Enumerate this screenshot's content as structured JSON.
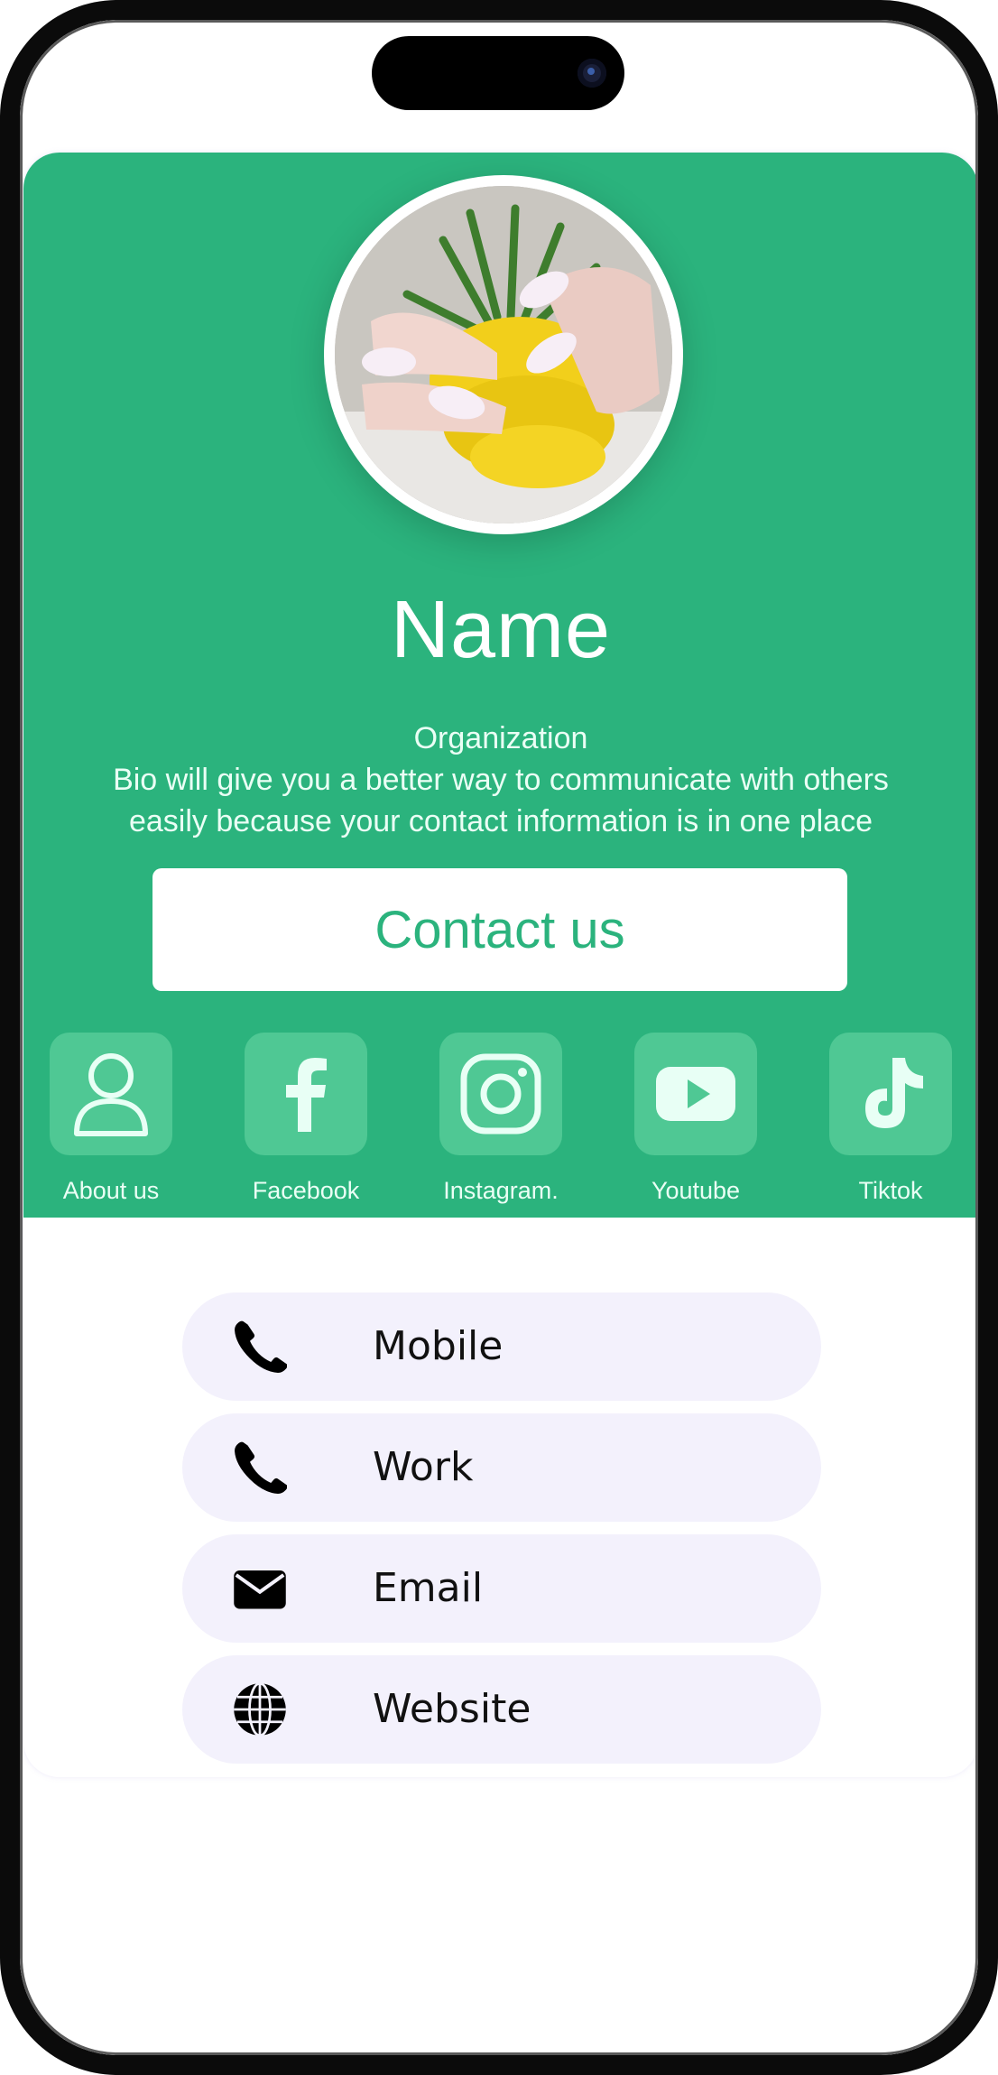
{
  "profile": {
    "name": "Name",
    "organization": "Organization",
    "bio": "Bio will give you a better way to communicate with others easily because your contact information is in one place"
  },
  "contact_button": {
    "label": "Contact us"
  },
  "socials": [
    {
      "label": "About us",
      "icon": "person-icon"
    },
    {
      "label": "Facebook",
      "icon": "facebook-icon"
    },
    {
      "label": "Instagram.",
      "icon": "instagram-icon"
    },
    {
      "label": "Youtube",
      "icon": "youtube-icon"
    },
    {
      "label": "Tiktok",
      "icon": "tiktok-icon"
    }
  ],
  "contacts": [
    {
      "label": "Mobile",
      "icon": "phone-icon"
    },
    {
      "label": "Work",
      "icon": "phone-icon"
    },
    {
      "label": "Email",
      "icon": "envelope-icon"
    },
    {
      "label": "Website",
      "icon": "globe-icon"
    }
  ],
  "colors": {
    "brand_green": "#2bb37d",
    "tile_green": "#4fc894",
    "row_background": "#f3f1fc"
  }
}
